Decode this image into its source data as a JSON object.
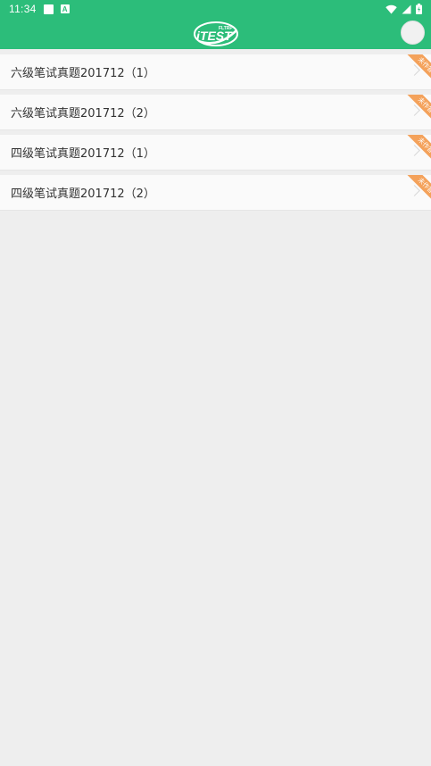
{
  "status_bar": {
    "time": "11:34",
    "notification_icon_letter": "A"
  },
  "app_bar": {
    "logo_text": "iTEST",
    "logo_subtext": "FLTRP"
  },
  "colors": {
    "primary": "#2cbd7a",
    "ribbon": "#f4a25b",
    "background": "#eeeeee",
    "card": "#fafafa"
  },
  "exam_list": [
    {
      "title": "六级笔试真题201712（1）",
      "badge": "未作答"
    },
    {
      "title": "六级笔试真题201712（2）",
      "badge": "未作答"
    },
    {
      "title": "四级笔试真题201712（1）",
      "badge": "未作答"
    },
    {
      "title": "四级笔试真题201712（2）",
      "badge": "未作答"
    }
  ]
}
